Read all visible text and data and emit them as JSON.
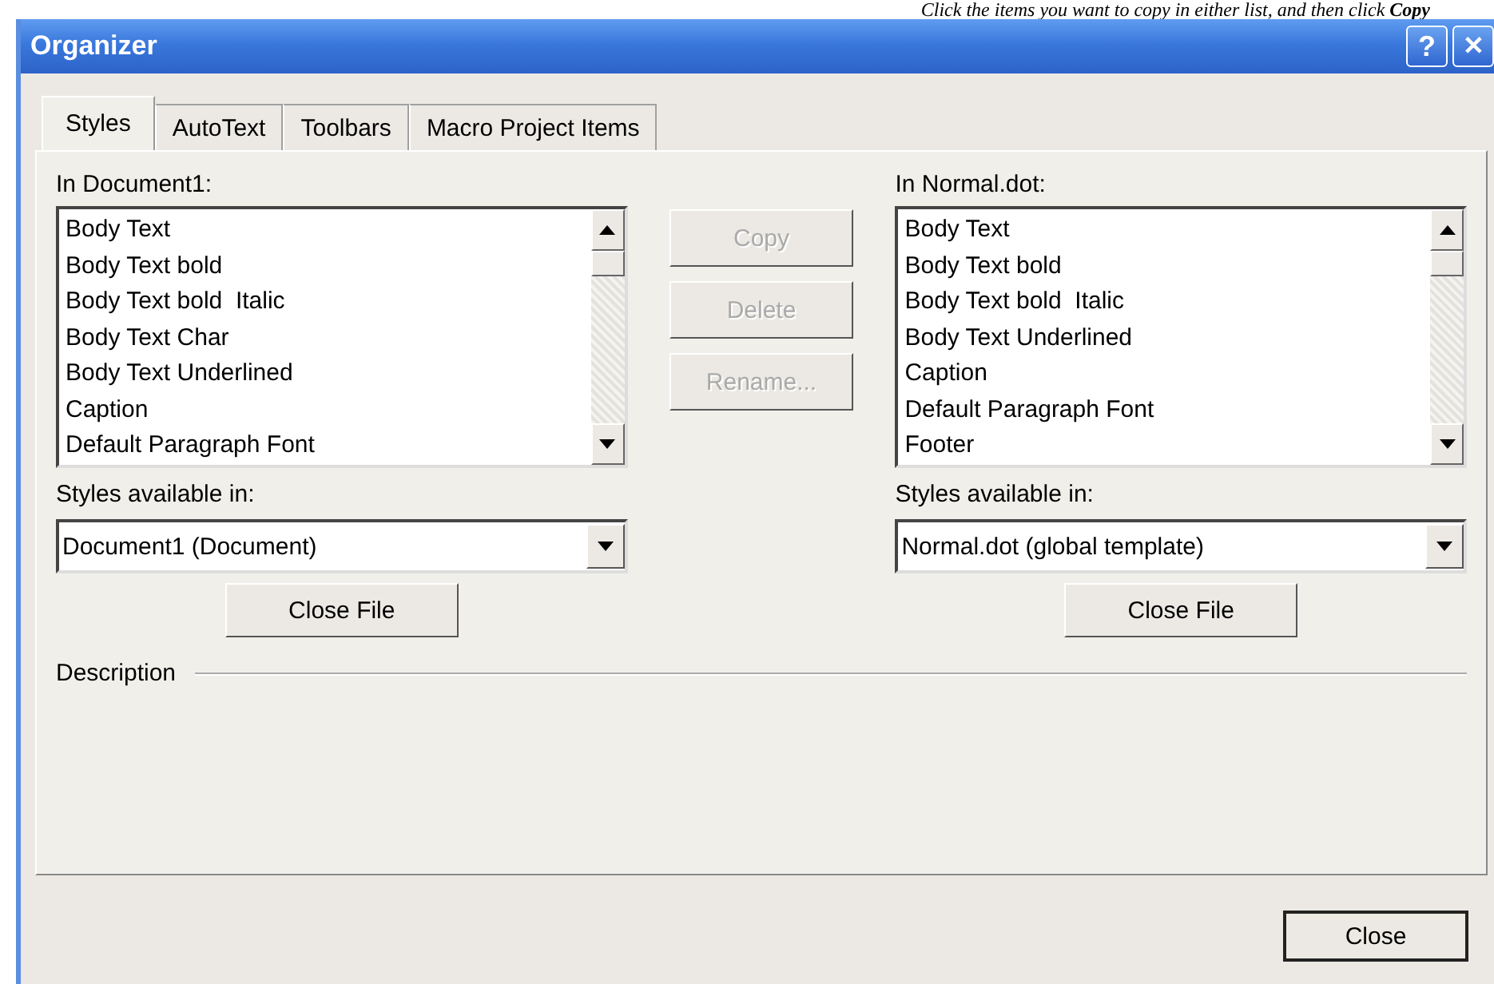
{
  "caption": "Click the items you want to copy in either list, and then click **Copy**",
  "window": {
    "title": "Organizer",
    "title_buttons": [
      {
        "kind": "help",
        "label": "?"
      },
      {
        "kind": "close",
        "label": "✕"
      }
    ]
  },
  "tabs": [
    {
      "label": "Styles",
      "selected": true
    },
    {
      "label": "AutoText",
      "selected": false
    },
    {
      "label": "Toolbars",
      "selected": false
    },
    {
      "label": "Macro Project Items",
      "selected": false
    }
  ],
  "left": {
    "label": "In Document1:",
    "items": [
      "Body Text",
      "Body Text bold",
      "Body Text bold  Italic",
      "Body Text Char",
      "Body Text Underlined",
      "Caption",
      "Default Paragraph Font"
    ],
    "available_label": "Styles available in:",
    "available_value": "Document1 (Document)",
    "close_file": "Close File"
  },
  "actions": [
    {
      "label": "Copy",
      "disabled": true
    },
    {
      "label": "Delete",
      "disabled": true
    },
    {
      "label": "Rename...",
      "disabled": true
    }
  ],
  "right": {
    "label": "In Normal.dot:",
    "items": [
      "Body Text",
      "Body Text bold",
      "Body Text bold  Italic",
      "Body Text Underlined",
      "Caption",
      "Default Paragraph Font",
      "Footer"
    ],
    "available_label": "Styles available in:",
    "available_value": "Normal.dot (global template)",
    "close_file": "Close File"
  },
  "description_label": "Description",
  "close_button": "Close"
}
